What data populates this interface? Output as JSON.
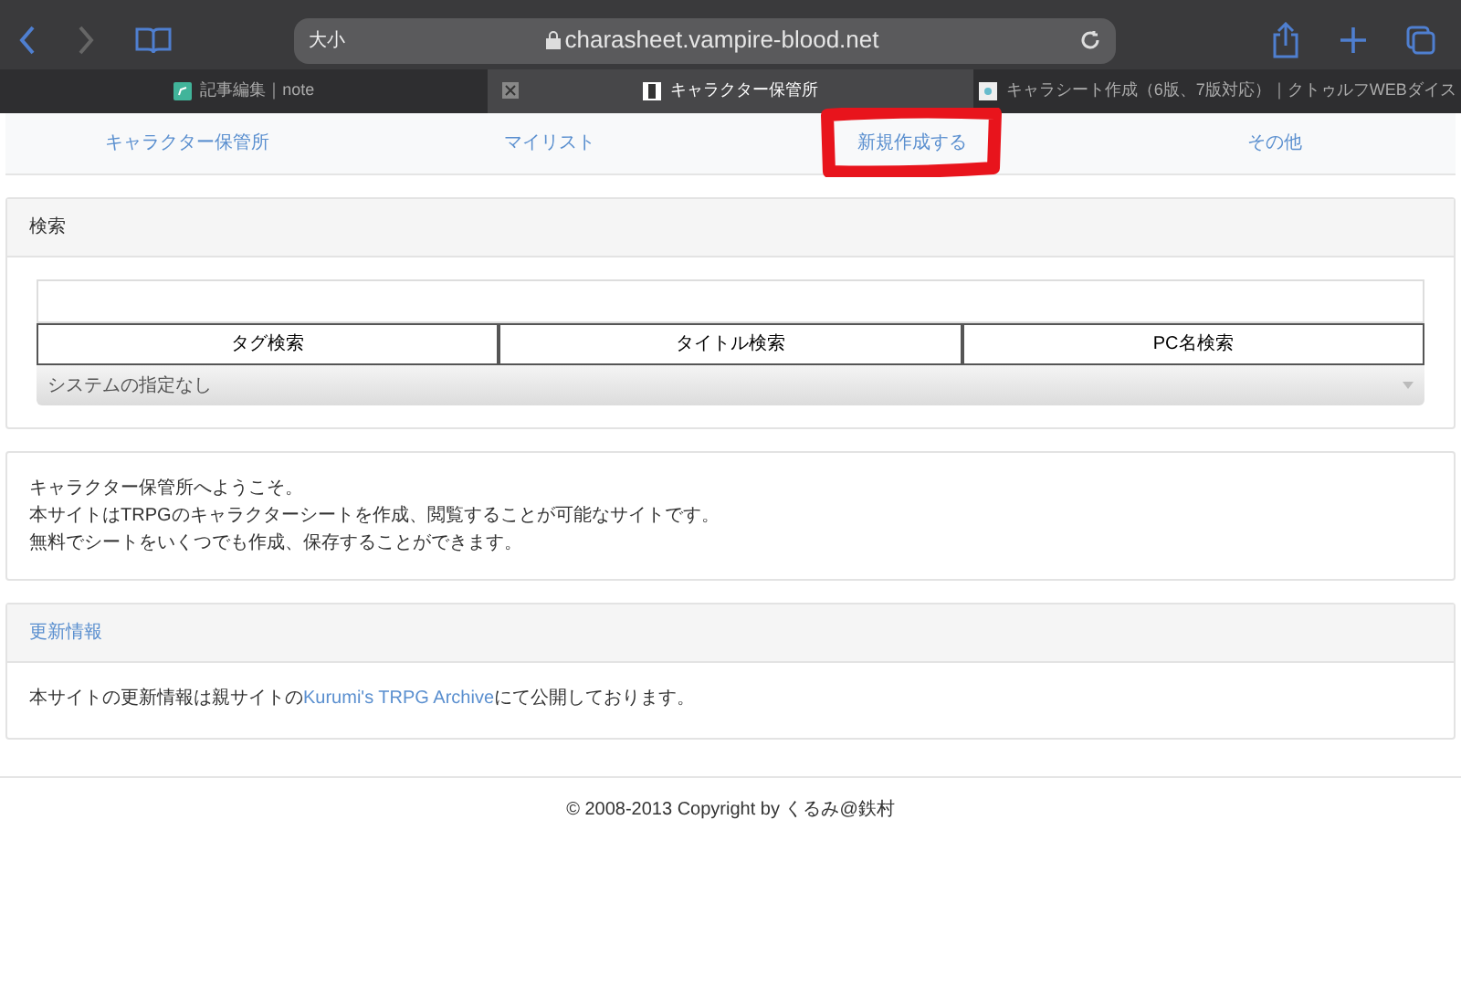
{
  "browser": {
    "address_left": "大小",
    "url": "charasheet.vampire-blood.net"
  },
  "tabs": [
    {
      "title": "記事編集｜note",
      "selected": false,
      "kind": "note"
    },
    {
      "title": "キャラクター保管所",
      "selected": true,
      "kind": "film"
    },
    {
      "title": "キャラシート作成（6版、7版対応）｜クトゥルフWEBダイス",
      "selected": false,
      "kind": "dice"
    }
  ],
  "nav": [
    {
      "label": "キャラクター保管所",
      "highlighted": false
    },
    {
      "label": "マイリスト",
      "highlighted": false
    },
    {
      "label": "新規作成する",
      "highlighted": true
    },
    {
      "label": "その他",
      "highlighted": false
    }
  ],
  "search": {
    "title": "検索",
    "buttons": [
      "タグ検索",
      "タイトル検索",
      "PC名検索"
    ],
    "system_select": "システムの指定なし"
  },
  "welcome": [
    "キャラクター保管所へようこそ。",
    "本サイトはTRPGのキャラクターシートを作成、閲覧することが可能なサイトです。",
    "無料でシートをいくつでも作成、保存することができます。"
  ],
  "updates": {
    "title": "更新情報",
    "text_before": "本サイトの更新情報は親サイトの",
    "link": "Kurumi's TRPG Archive",
    "text_after": "にて公開しております。"
  },
  "footer": "© 2008-2013 Copyright by くるみ@鉄村"
}
